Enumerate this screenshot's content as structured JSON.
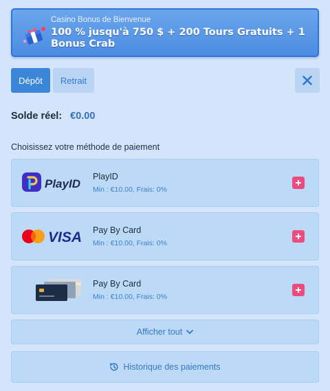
{
  "banner": {
    "subtitle": "Casino Bonus de Bienvenue",
    "headline": "100 % jusqu'à 750 $ + 200 Tours Gratuits + 1 Bonus Crab",
    "icon": "gift-icon"
  },
  "tabs": [
    {
      "label": "Dépôt",
      "active": true
    },
    {
      "label": "Retrait",
      "active": false
    }
  ],
  "close_icon": "close-icon",
  "balance": {
    "label": "Solde réel:",
    "amount": "€0.00"
  },
  "methods_title": "Choisissez votre méthode de paiement",
  "methods": [
    {
      "name": "PlayID",
      "meta": "Min : €10.00, Frais: 0%",
      "logo": "PlayID"
    },
    {
      "name": "Pay By Card",
      "meta": "Min : €10.00, Frais: 0%",
      "logo": "VISA"
    },
    {
      "name": "Pay By Card",
      "meta": "Min : €10.00, Frais: 0%",
      "logo": "card-icon"
    }
  ],
  "show_all": "Afficher tout",
  "history": "Historique des paiements",
  "colors": {
    "accent": "#3b86d8",
    "plus": "#ee4c7f",
    "background": "#d4e4fb",
    "card": "#bcdaf5"
  }
}
